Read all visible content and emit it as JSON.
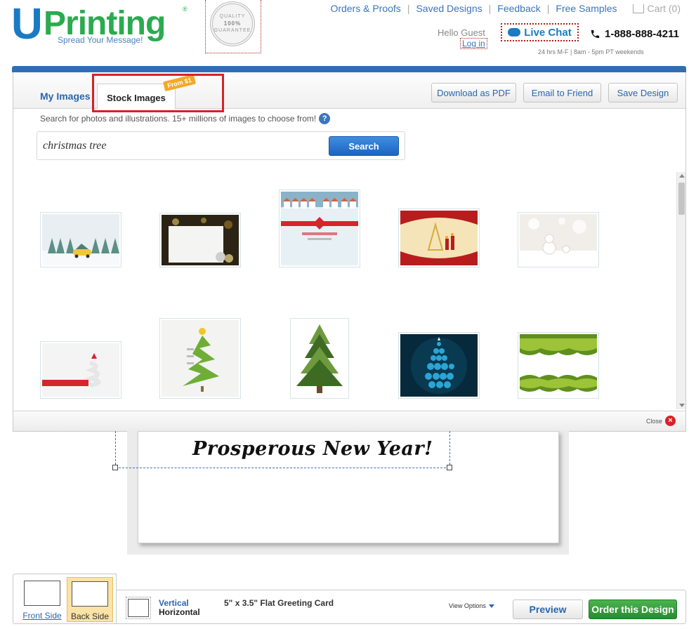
{
  "brand": {
    "logo_u": "U",
    "logo_printing": "Printing",
    "logo_reg": "®",
    "tagline": "Spread Your Message!",
    "seal": {
      "top": "QUALITY",
      "middle": "100%",
      "bottom": "GUARANTEE"
    }
  },
  "topnav": {
    "items": [
      "Orders & Proofs",
      "Saved Designs",
      "Feedback",
      "Free Samples"
    ],
    "cart_label": "Cart (0)"
  },
  "account": {
    "hello": "Hello Guest",
    "login": "Log in",
    "live_chat": "Live Chat",
    "phone": "1-888-888-4211",
    "hours": "24 hrs M-F | 8am - 5pm PT weekends"
  },
  "panel": {
    "tabs": {
      "my_images": "My Images",
      "stock_images": "Stock Images",
      "badge": "From $1"
    },
    "buttons": {
      "download_pdf": "Download as PDF",
      "email_friend": "Email to Friend",
      "save_design": "Save Design"
    },
    "hint": "Search for photos and illustrations. 15+ millions of images to choose from!",
    "help": "?",
    "search": {
      "value": "christmas tree",
      "button": "Search"
    },
    "close_label": "Close",
    "close_icon": "×"
  },
  "results": [
    {
      "icon": "snow-car-trees-thumbnail",
      "colors": [
        "#e9eef2",
        "#5c8f86",
        "#f0c63a"
      ]
    },
    {
      "icon": "card-ornaments-thumbnail",
      "colors": [
        "#2b2414",
        "#f4f4f2",
        "#b9a86a"
      ]
    },
    {
      "icon": "snowy-village-ribbon-thumbnail",
      "colors": [
        "#e7f1f5",
        "#d8242e",
        "#8ab2c8"
      ]
    },
    {
      "icon": "red-gold-tree-card-thumbnail",
      "colors": [
        "#b71d1d",
        "#f4e4b8",
        "#d9a93a"
      ]
    },
    {
      "icon": "snowman-bokeh-thumbnail",
      "colors": [
        "#f1ede8",
        "#ddd5cb",
        "#ffffff"
      ]
    },
    {
      "icon": "paper-tree-red-ribbon-thumbnail",
      "colors": [
        "#f4f4f4",
        "#d8242e",
        "#e6e6e6"
      ]
    },
    {
      "icon": "green-paper-tree-thumbnail",
      "colors": [
        "#f3f3f1",
        "#6fae36",
        "#f0c72b"
      ]
    },
    {
      "icon": "pine-tree-thumbnail",
      "colors": [
        "#ffffff",
        "#3d6b24",
        "#6e9a3e"
      ]
    },
    {
      "icon": "blue-ball-tree-thumbnail",
      "colors": [
        "#062a3b",
        "#2aa5d4",
        "#0c4660"
      ]
    },
    {
      "icon": "fir-branches-border-thumbnail",
      "colors": [
        "#ffffff",
        "#5f8f1f",
        "#9dc339"
      ]
    }
  ],
  "card": {
    "text": "Prosperous New Year!"
  },
  "sides": {
    "front": "Front Side",
    "back": "Back Side"
  },
  "infobar": {
    "vertical": "Vertical",
    "horizontal": "Horizontal",
    "product": "5\" x 3.5\" Flat Greeting Card",
    "view_options": "View Options",
    "preview": "Preview",
    "order": "Order this Design"
  }
}
